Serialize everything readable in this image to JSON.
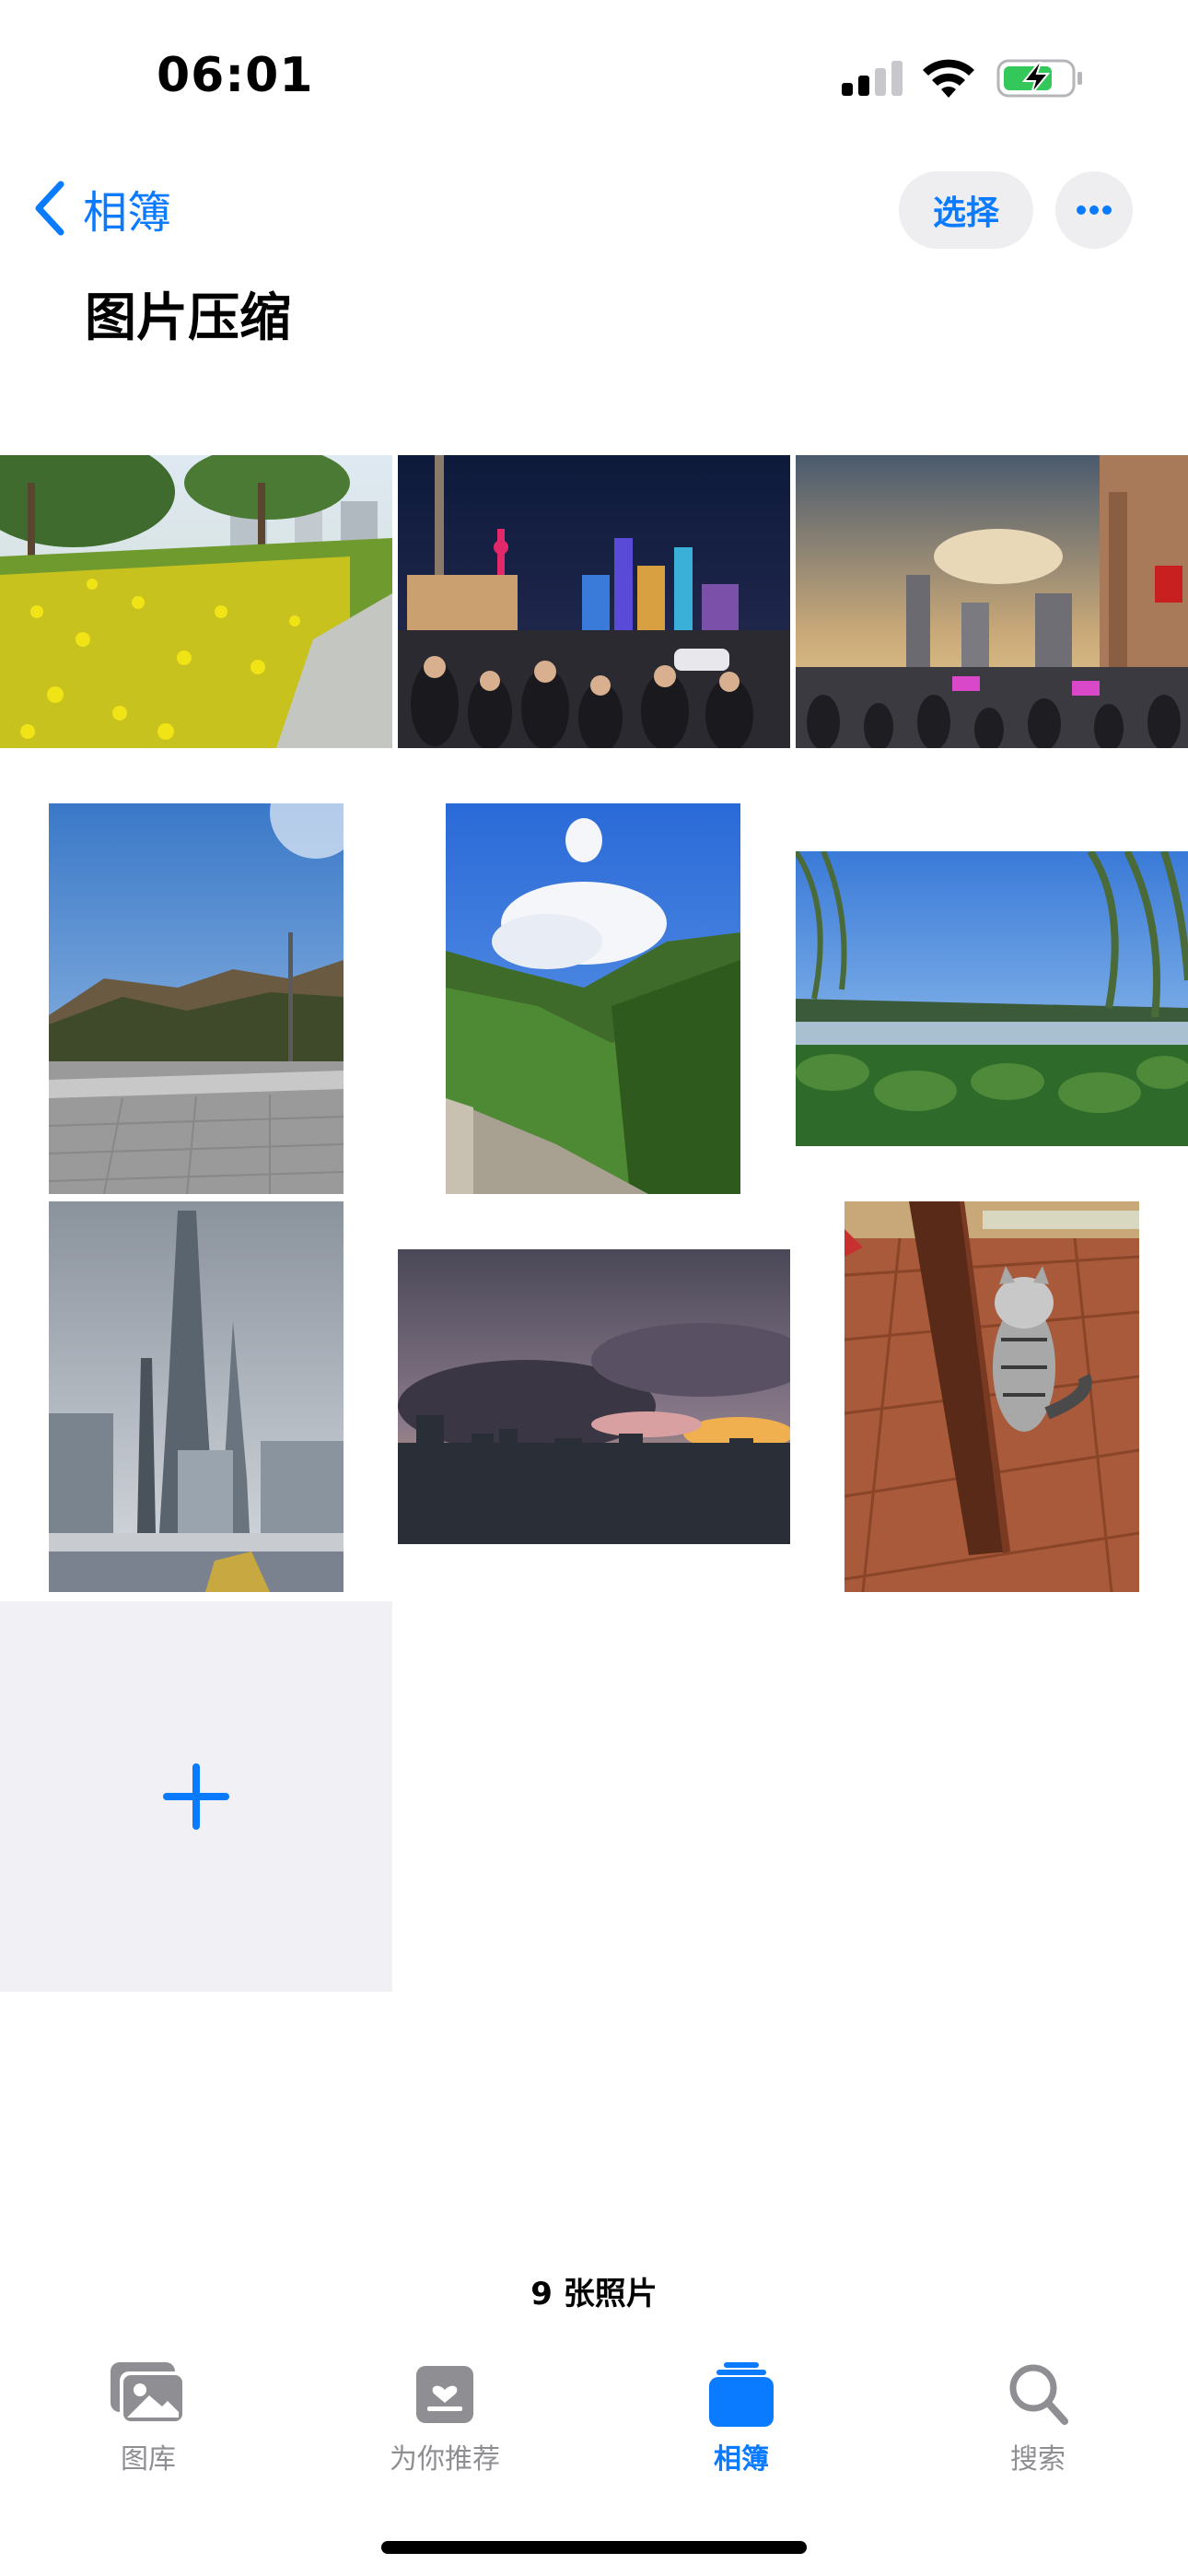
{
  "status_bar": {
    "time": "06:01",
    "battery_charging": true
  },
  "nav": {
    "back_label": "相簿",
    "select_label": "选择",
    "more_icon": "ellipsis-icon"
  },
  "album": {
    "title": "图片压缩",
    "photo_count_label": "9 张照片"
  },
  "photos": [
    {
      "subject": "yellow-flowers-park"
    },
    {
      "subject": "city-night-crowd"
    },
    {
      "subject": "skyline-sunset-plaza"
    },
    {
      "subject": "hillside-road-blue-sky"
    },
    {
      "subject": "forest-valley-clouds"
    },
    {
      "subject": "lake-willow-trees"
    },
    {
      "subject": "shanghai-towers"
    },
    {
      "subject": "sunset-clouds-city"
    },
    {
      "subject": "cat-by-table-leg"
    }
  ],
  "add_tile": {
    "icon": "plus-icon"
  },
  "tabbar": {
    "tabs": [
      {
        "label": "图库",
        "icon": "photos-library-icon",
        "active": false
      },
      {
        "label": "为你推荐",
        "icon": "for-you-icon",
        "active": false
      },
      {
        "label": "相簿",
        "icon": "albums-icon",
        "active": true
      },
      {
        "label": "搜索",
        "icon": "search-icon",
        "active": false
      }
    ]
  },
  "colors": {
    "accent": "#0a7aff",
    "inactive": "#8e8e93",
    "tile_bg": "#f1f1f5"
  }
}
